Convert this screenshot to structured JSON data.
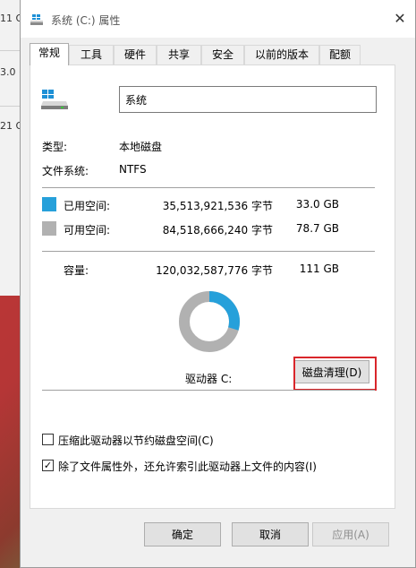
{
  "background": {
    "texts": [
      "11 O",
      "3.0 (",
      "21 O"
    ]
  },
  "window": {
    "title": "系统 (C:) 属性",
    "close_glyph": "✕"
  },
  "tabs": [
    {
      "label": "常规",
      "active": true
    },
    {
      "label": "工具",
      "active": false
    },
    {
      "label": "硬件",
      "active": false
    },
    {
      "label": "共享",
      "active": false
    },
    {
      "label": "安全",
      "active": false
    },
    {
      "label": "以前的版本",
      "active": false
    },
    {
      "label": "配额",
      "active": false
    }
  ],
  "general": {
    "drive_name": "系统",
    "type_label": "类型:",
    "type_value": "本地磁盘",
    "fs_label": "文件系统:",
    "fs_value": "NTFS",
    "used": {
      "label": "已用空间:",
      "bytes": "35,513,921,536 字节",
      "size": "33.0 GB",
      "color": "#26a0da"
    },
    "free": {
      "label": "可用空间:",
      "bytes": "84,518,666,240 字节",
      "size": "78.7 GB",
      "color": "#b1b1b1"
    },
    "capacity": {
      "label": "容量:",
      "bytes": "120,032,587,776 字节",
      "size": "111 GB"
    },
    "used_fraction": 0.296,
    "drive_label": "驱动器 C:",
    "cleanup_button": "磁盘清理(D)",
    "compress_label": "压缩此驱动器以节约磁盘空间(C)",
    "compress_checked": false,
    "index_label": "除了文件属性外，还允许索引此驱动器上文件的内容(I)",
    "index_checked": true,
    "check_glyph": "✓"
  },
  "buttons": {
    "ok": "确定",
    "cancel": "取消",
    "apply": "应用(A)"
  },
  "colors": {
    "highlight": "#d9262b",
    "accent": "#0078d7"
  }
}
